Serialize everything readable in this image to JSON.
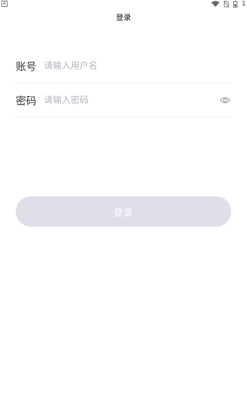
{
  "status_bar": {
    "left_glyph": "A",
    "time": "1"
  },
  "header": {
    "title": "登录"
  },
  "form": {
    "account": {
      "label": "账号",
      "placeholder": "请输入用户名",
      "value": ""
    },
    "password": {
      "label": "密码",
      "placeholder": "请输入密码",
      "value": "",
      "visibility_icon": "eye-icon"
    }
  },
  "actions": {
    "login_label": "登录",
    "login_color": "#dedfe9"
  }
}
